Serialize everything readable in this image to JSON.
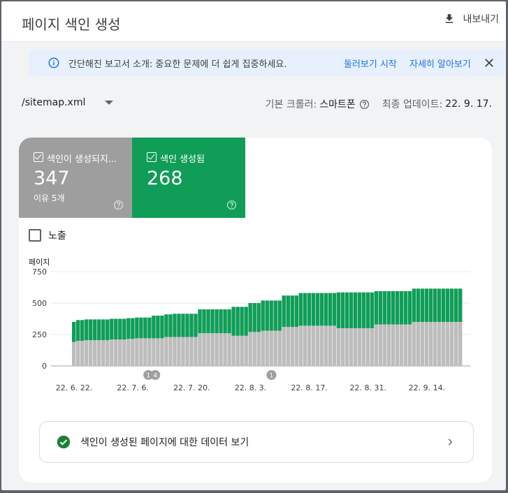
{
  "header": {
    "title": "페이지 색인 생성",
    "export_label": "내보내기"
  },
  "banner": {
    "message": "간단해진 보고서 소개: 중요한 문제에 더 쉽게 집중하세요.",
    "tour_link": "둘러보기 시작",
    "learn_link": "자세히 알아보기"
  },
  "filter": {
    "sitemap_value": "/sitemap.xml",
    "crawler_label": "기본 크롤러:",
    "crawler_value": "스마트폰",
    "updated_label": "최종 업데이트:",
    "updated_value": "22. 9. 17."
  },
  "tiles": {
    "not_indexed": {
      "label": "색인이 생성되지...",
      "count": "347",
      "sub": "이유 5개"
    },
    "indexed": {
      "label": "색인 생성됨",
      "count": "268"
    }
  },
  "impressions_label": "노출",
  "colors": {
    "not_indexed": "#bdbdbd",
    "indexed": "#0f9d58",
    "grid": "#e8eaed"
  },
  "chart_data": {
    "type": "bar",
    "stacked": true,
    "ylabel": "페이지",
    "ylim": [
      0,
      750
    ],
    "yticks": [
      0,
      250,
      500,
      750
    ],
    "xticks": [
      "22. 6. 22.",
      "22. 7. 6.",
      "22. 7. 20.",
      "22. 8. 3.",
      "22. 8. 17.",
      "22. 8. 31.",
      "22. 9. 14."
    ],
    "annotations": [
      {
        "label": "1",
        "day": 18
      },
      {
        "label": "4",
        "day": 19
      },
      {
        "label": "1",
        "day": 47
      }
    ],
    "series": [
      {
        "name": "색인이 생성되지 않음",
        "values": [
          190,
          200,
          200,
          205,
          205,
          205,
          205,
          205,
          205,
          210,
          210,
          210,
          210,
          215,
          215,
          220,
          220,
          220,
          220,
          220,
          220,
          220,
          230,
          230,
          230,
          230,
          230,
          230,
          230,
          230,
          260,
          260,
          260,
          260,
          260,
          260,
          260,
          260,
          240,
          240,
          240,
          240,
          270,
          270,
          270,
          280,
          280,
          280,
          280,
          280,
          310,
          310,
          310,
          310,
          320,
          320,
          320,
          320,
          320,
          320,
          320,
          320,
          320,
          300,
          300,
          300,
          300,
          300,
          300,
          300,
          300,
          300,
          330,
          330,
          330,
          330,
          330,
          330,
          330,
          330,
          330,
          350,
          350,
          350,
          350,
          350,
          350,
          350,
          350,
          350,
          350,
          350,
          350
        ]
      },
      {
        "name": "색인 생성됨",
        "values": [
          160,
          165,
          165,
          165,
          165,
          165,
          165,
          165,
          165,
          165,
          165,
          165,
          165,
          165,
          165,
          165,
          165,
          165,
          165,
          180,
          180,
          180,
          180,
          180,
          185,
          185,
          185,
          185,
          185,
          185,
          190,
          190,
          190,
          190,
          190,
          190,
          190,
          190,
          230,
          230,
          230,
          230,
          230,
          230,
          230,
          240,
          240,
          240,
          240,
          240,
          250,
          250,
          250,
          250,
          260,
          260,
          260,
          260,
          260,
          260,
          260,
          260,
          260,
          285,
          285,
          285,
          285,
          285,
          285,
          285,
          285,
          285,
          265,
          265,
          265,
          265,
          265,
          265,
          265,
          265,
          265,
          265,
          265,
          265,
          265,
          265,
          265,
          265,
          265,
          265,
          265,
          265,
          265
        ]
      }
    ]
  },
  "bottom_link_label": "색인이 생성된 페이지에 대한 데이터 보기"
}
